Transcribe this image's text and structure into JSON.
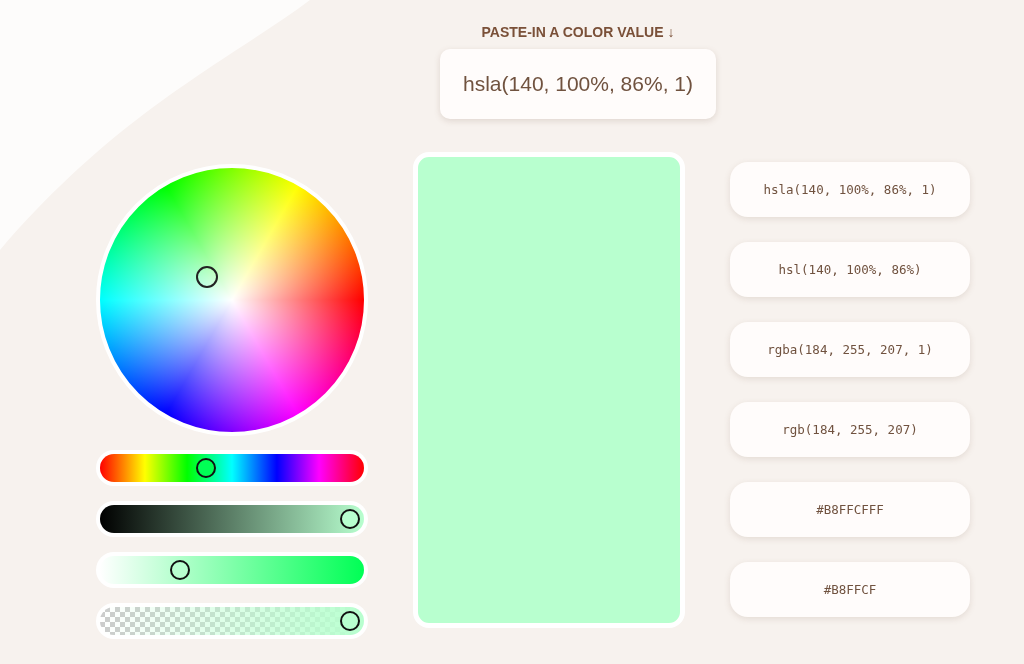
{
  "input": {
    "label": "PASTE-IN A COLOR VALUE ↓",
    "value": "hsla(140, 100%, 86%, 1)"
  },
  "preview": {
    "color": "#b8ffcf"
  },
  "sliders": [
    {
      "kind": "hue",
      "level": 0.39
    },
    {
      "kind": "lightness",
      "level": 1
    },
    {
      "kind": "saturation",
      "level": 0.28
    },
    {
      "kind": "alpha",
      "level": 1
    }
  ],
  "formats": [
    "hsla(140, 100%, 86%, 1)",
    "hsl(140, 100%, 86%)",
    "rgba(184, 255, 207, 1)",
    "rgb(184, 255, 207)",
    "#B8FFCFFF",
    "#B8FFCF"
  ]
}
